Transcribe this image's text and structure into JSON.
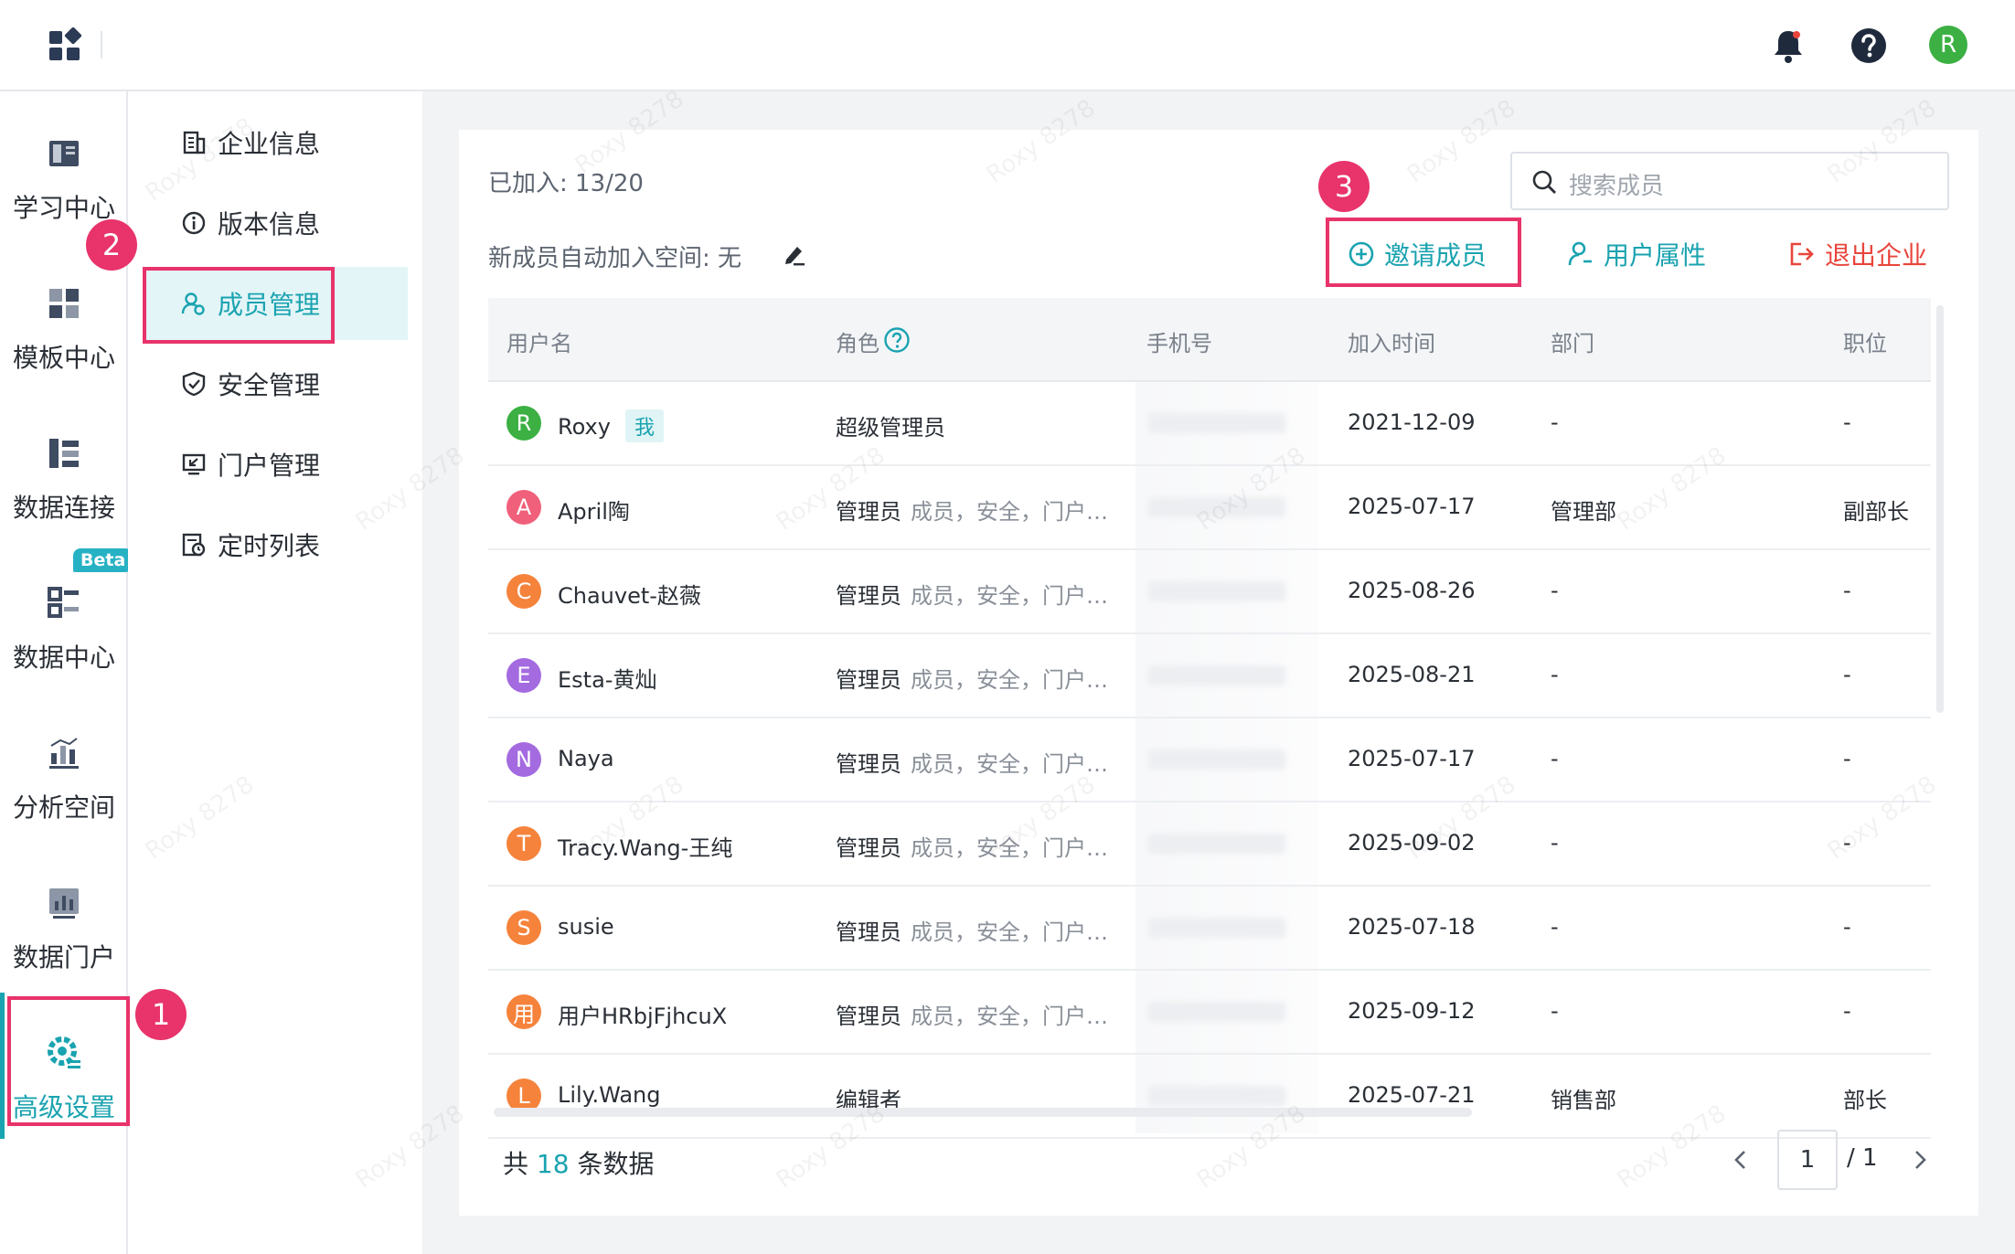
{
  "watermark": "Roxy 8278",
  "topbar": {
    "avatar_letter": "R"
  },
  "leftnav": {
    "items": [
      {
        "label": "学习中心",
        "icon": "book-icon"
      },
      {
        "label": "模板中心",
        "icon": "template-icon"
      },
      {
        "label": "数据连接",
        "icon": "data-connect-icon"
      },
      {
        "label": "数据中心",
        "icon": "data-center-icon",
        "badge": "Beta"
      },
      {
        "label": "分析空间",
        "icon": "analysis-icon"
      },
      {
        "label": "数据门户",
        "icon": "portal-chart-icon"
      },
      {
        "label": "高级设置",
        "icon": "advanced-settings-icon",
        "active": true
      }
    ]
  },
  "subnav": {
    "items": [
      {
        "label": "企业信息",
        "icon": "building-icon"
      },
      {
        "label": "版本信息",
        "icon": "info-icon"
      },
      {
        "label": "成员管理",
        "icon": "members-icon",
        "active": true
      },
      {
        "label": "安全管理",
        "icon": "shield-icon"
      },
      {
        "label": "门户管理",
        "icon": "portal-icon"
      },
      {
        "label": "定时列表",
        "icon": "schedule-icon"
      }
    ]
  },
  "main": {
    "joined": "已加入: 13/20",
    "auto_join": "新成员自动加入空间: 无",
    "search_placeholder": "搜索成员",
    "actions": {
      "invite": "邀请成员",
      "attributes": "用户属性",
      "exit": "退出企业"
    },
    "columns": [
      "用户名",
      "角色",
      "手机号",
      "加入时间",
      "部门",
      "职位"
    ],
    "me_tag": "我",
    "rows": [
      {
        "avatar": "R",
        "color": "#3cb043",
        "name": "Roxy",
        "me": true,
        "role": "超级管理员",
        "perms": "",
        "date": "2021-12-09",
        "dept": "-",
        "pos": "-"
      },
      {
        "avatar": "A",
        "color": "#f0607a",
        "name": "April陶",
        "role": "管理员",
        "perms": "成员，安全，门户…",
        "date": "2025-07-17",
        "dept": "管理部",
        "pos": "副部长"
      },
      {
        "avatar": "C",
        "color": "#f5833c",
        "name": "Chauvet-赵薇",
        "role": "管理员",
        "perms": "成员，安全，门户…",
        "date": "2025-08-26",
        "dept": "-",
        "pos": "-"
      },
      {
        "avatar": "E",
        "color": "#a46be0",
        "name": "Esta-黄灿",
        "role": "管理员",
        "perms": "成员，安全，门户…",
        "date": "2025-08-21",
        "dept": "-",
        "pos": "-"
      },
      {
        "avatar": "N",
        "color": "#a46be0",
        "name": "Naya",
        "role": "管理员",
        "perms": "成员，安全，门户…",
        "date": "2025-07-17",
        "dept": "-",
        "pos": "-"
      },
      {
        "avatar": "T",
        "color": "#f5833c",
        "name": "Tracy.Wang-王纯",
        "role": "管理员",
        "perms": "成员，安全，门户…",
        "date": "2025-09-02",
        "dept": "-",
        "pos": "-"
      },
      {
        "avatar": "S",
        "color": "#f5833c",
        "name": "susie",
        "role": "管理员",
        "perms": "成员，安全，门户…",
        "date": "2025-07-18",
        "dept": "-",
        "pos": "-"
      },
      {
        "avatar": "用",
        "color": "#f5833c",
        "name": "用户HRbjFjhcuX",
        "role": "管理员",
        "perms": "成员，安全，门户…",
        "date": "2025-09-12",
        "dept": "-",
        "pos": "-"
      },
      {
        "avatar": "L",
        "color": "#f5833c",
        "name": "Lily.Wang",
        "role": "编辑者",
        "perms": "",
        "date": "2025-07-21",
        "dept": "销售部",
        "pos": "部长"
      }
    ],
    "total_prefix": "共",
    "total_count": "18",
    "total_suffix": "条数据",
    "page_current": "1",
    "page_total": "/ 1"
  },
  "annotations": [
    "1",
    "2",
    "3"
  ],
  "colors": {
    "accent": "#1aa3b0",
    "danger": "#e8453c",
    "highlight": "#e8336b"
  }
}
